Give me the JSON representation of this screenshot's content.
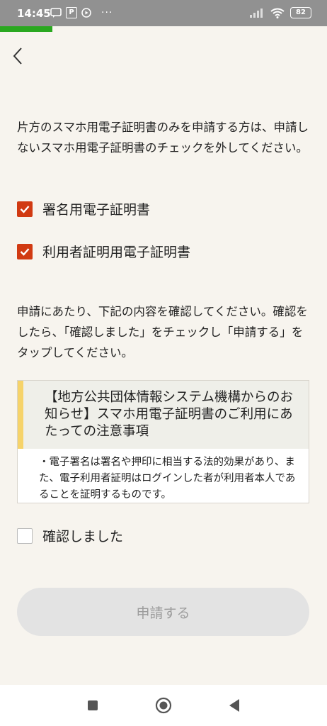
{
  "status_bar": {
    "time": "14:45",
    "left_icons": [
      "message-icon",
      "pay-icon",
      "media-play-icon"
    ],
    "more": "···",
    "battery": "82"
  },
  "progress": {
    "fraction": 0.16,
    "color": "#2aa820"
  },
  "intro_text": "片方のスマホ用電子証明書のみを申請する方は、申請しないスマホ用電子証明書のチェックを外してください。",
  "certificates": [
    {
      "label": "署名用電子証明書",
      "checked": true
    },
    {
      "label": "利用者証明用電子証明書",
      "checked": true
    }
  ],
  "instruction_text": "申請にあたり、下記の内容を確認してください。確認をしたら、「確認しました」をチェックし「申請する」をタップしてください。",
  "notice": {
    "title": "【地方公共団体情報システム機構からのお知らせ】スマホ用電子証明書のご利用にあたっての注意事項",
    "body": "・電子署名は署名や押印に相当する法的効果があり、また、電子利用者証明はログインした者が利用者本人であることを証明するものです。"
  },
  "confirm": {
    "label": "確認しました",
    "checked": false
  },
  "submit_label": "申請する",
  "colors": {
    "accent": "#d13a12",
    "notice_bar": "#f6d36a"
  }
}
